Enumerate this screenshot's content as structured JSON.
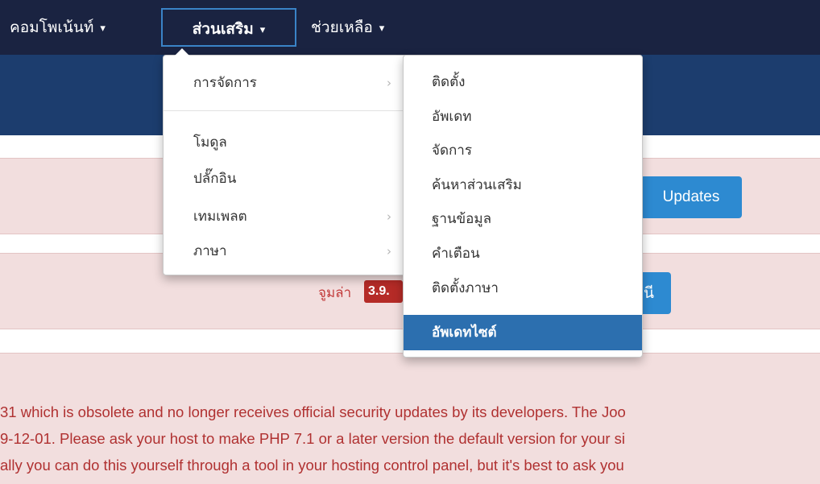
{
  "navbar": {
    "items": [
      {
        "label": "คอมโพเน้นท์",
        "caret": "▾"
      },
      {
        "label": "ส่วนเสริม",
        "caret": "▾"
      },
      {
        "label": "ช่วยเหลือ",
        "caret": "▾"
      }
    ],
    "active_index": 1
  },
  "extensions_menu": {
    "items": [
      {
        "label": "การจัดการ",
        "has_submenu": true
      },
      {
        "label": "โมดูล",
        "has_submenu": false
      },
      {
        "label": "ปลั๊กอิน",
        "has_submenu": false
      },
      {
        "label": "เทมเพลต",
        "has_submenu": true
      },
      {
        "label": "ภาษา",
        "has_submenu": true
      }
    ],
    "submenu_icon": "chevron-right-icon",
    "submenu_glyph": "›"
  },
  "manage_menu": {
    "items": [
      {
        "label": "ติดตั้ง"
      },
      {
        "label": "อัพเดท"
      },
      {
        "label": "จัดการ"
      },
      {
        "label": "ค้นหาส่วนเสริม"
      },
      {
        "label": "ฐานข้อมูล"
      },
      {
        "label": "คำเตือน"
      },
      {
        "label": "ติดตั้งภาษา"
      },
      {
        "label": "อัพเดทไซต์"
      }
    ],
    "highlighted_index": 7
  },
  "page": {
    "updates_button_label": "Updates",
    "joomla_text": "จูมล่า",
    "version_badge": "3.9.",
    "right_button_label": "นี",
    "warning_lines": [
      "31 which is obsolete and no longer receives official security updates by its developers. The Joo",
      "9-12-01. Please ask your host to make PHP 7.1 or a later version the default version for your si",
      "ally you can do this yourself through a tool in your hosting control panel, but it's best to ask you"
    ]
  },
  "colors": {
    "navbar": "#1a2341",
    "header_band": "#1c3d6e",
    "alert_bg": "#f2dede",
    "accent_blue": "#2d8ad1",
    "highlight": "#2c6faf",
    "danger_text": "#b03131"
  }
}
